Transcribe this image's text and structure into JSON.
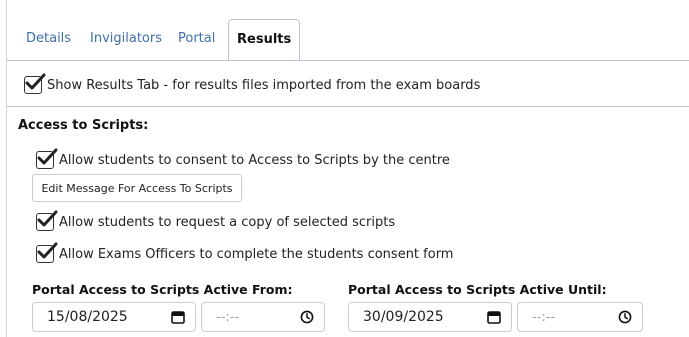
{
  "tabs": [
    {
      "label": "Details"
    },
    {
      "label": "Invigilators"
    },
    {
      "label": "Portal"
    },
    {
      "label": "Results"
    }
  ],
  "active_tab": "Results",
  "show_results": {
    "label": "Show Results Tab - for results files imported from the exam boards",
    "checked": true
  },
  "access": {
    "section_title": "Access to Scripts:",
    "consent_label": "Allow students to consent to Access to Scripts by the centre",
    "edit_message_button": "Edit Message For Access To Scripts",
    "request_copy_label": "Allow students to request a copy of selected scripts",
    "officers_label": "Allow Exams Officers to complete the students consent form"
  },
  "portal": {
    "from_label": "Portal Access to Scripts Active From:",
    "from_date": "15/08/2025",
    "from_time": "--:--",
    "until_label": "Portal Access to Scripts Active Until:",
    "until_date": "30/09/2025",
    "until_time": "--:--"
  },
  "colors": {
    "tab_link": "#3d6fb6",
    "border": "#b7c2d3"
  }
}
